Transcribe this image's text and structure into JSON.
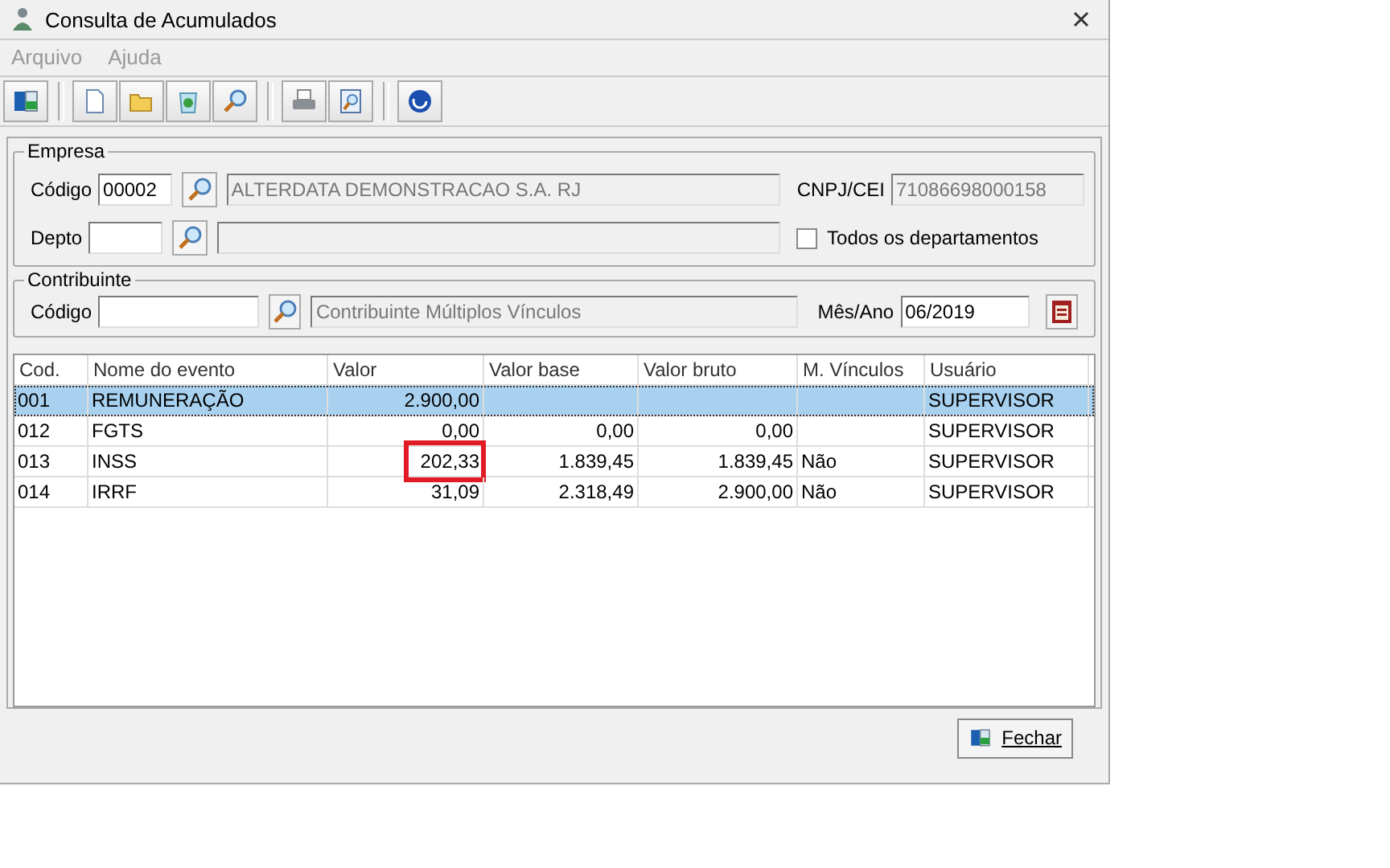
{
  "window": {
    "title": "Consulta de Acumulados"
  },
  "menu": [
    {
      "label": "Arquivo",
      "disabled": true
    },
    {
      "label": "Ajuda",
      "disabled": true
    }
  ],
  "toolbar": [
    {
      "kind": "exit"
    },
    {
      "kind": "sep"
    },
    {
      "kind": "new"
    },
    {
      "kind": "open"
    },
    {
      "kind": "recycle"
    },
    {
      "kind": "search"
    },
    {
      "kind": "sep"
    },
    {
      "kind": "print"
    },
    {
      "kind": "preview"
    },
    {
      "kind": "sep"
    },
    {
      "kind": "help"
    }
  ],
  "empresa": {
    "legend": "Empresa",
    "codigo_label": "Código",
    "codigo": "00002",
    "nome": "ALTERDATA DEMONSTRACAO S.A. RJ",
    "cnpj_label": "CNPJ/CEI",
    "cnpj": "71086698000158",
    "depto_label": "Depto",
    "todos_label": "Todos os departamentos",
    "todos_checked": false
  },
  "contribuinte": {
    "legend": "Contribuinte",
    "codigo_label": "Código",
    "nome": "Contribuinte Múltiplos Vínculos",
    "mes_label": "Mês/Ano",
    "mes": "06/2019"
  },
  "table": {
    "columns": [
      "Cod.",
      "Nome do evento",
      "Valor",
      "Valor base",
      "Valor bruto",
      "M. Vínculos",
      "Usuário"
    ],
    "rows": [
      {
        "cells": [
          "001",
          "REMUNERAÇÃO",
          "2.900,00",
          "",
          "",
          "",
          "SUPERVISOR"
        ],
        "selected": true,
        "valor_marked": false
      },
      {
        "cells": [
          "012",
          "FGTS",
          "0,00",
          "0,00",
          "0,00",
          "",
          "SUPERVISOR"
        ],
        "selected": false,
        "valor_marked": false
      },
      {
        "cells": [
          "013",
          "INSS",
          "202,33",
          "1.839,45",
          "1.839,45",
          "Não",
          "SUPERVISOR"
        ],
        "selected": false,
        "valor_marked": true
      },
      {
        "cells": [
          "014",
          "IRRF",
          "31,09",
          "2.318,49",
          "2.900,00",
          "Não",
          "SUPERVISOR"
        ],
        "selected": false,
        "valor_marked": false
      }
    ]
  },
  "close_button": {
    "label": "Fechar"
  }
}
